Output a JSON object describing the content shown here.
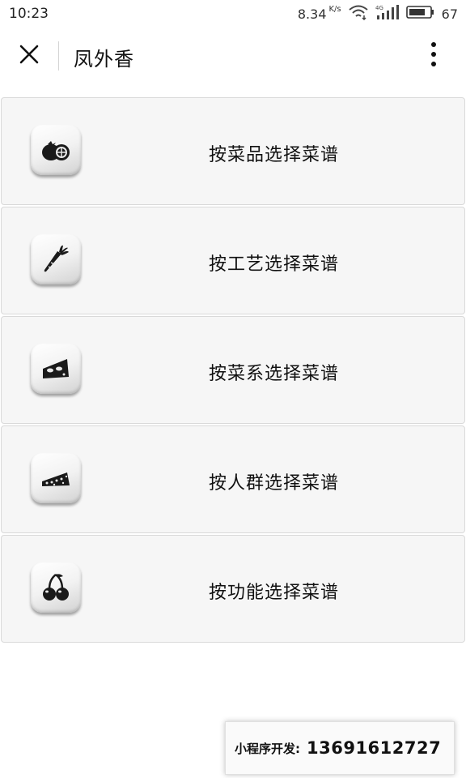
{
  "status_bar": {
    "time": "10:23",
    "net_speed": "8.34",
    "net_speed_unit": "K/s",
    "battery": "67",
    "icons": [
      "wifi-icon",
      "signal-4g-icon",
      "battery-icon"
    ]
  },
  "header": {
    "title": "凤外香",
    "close_icon": "close-icon",
    "more_icon": "more-vertical-icon"
  },
  "menu": {
    "items": [
      {
        "label": "按菜品选择菜谱",
        "icon": "tomato-icon"
      },
      {
        "label": "按工艺选择菜谱",
        "icon": "carrot-icon"
      },
      {
        "label": "按菜系选择菜谱",
        "icon": "cheese-mask-icon"
      },
      {
        "label": "按人群选择菜谱",
        "icon": "cake-slice-icon"
      },
      {
        "label": "按功能选择菜谱",
        "icon": "cherries-icon"
      }
    ]
  },
  "developer": {
    "label": "小程序开发:",
    "phone": "13691612727"
  },
  "colors": {
    "background": "#ffffff",
    "item_background": "#f6f6f6",
    "item_border": "#d9d9d9",
    "icon_glyph": "#1a1a1a",
    "text": "#111111"
  }
}
